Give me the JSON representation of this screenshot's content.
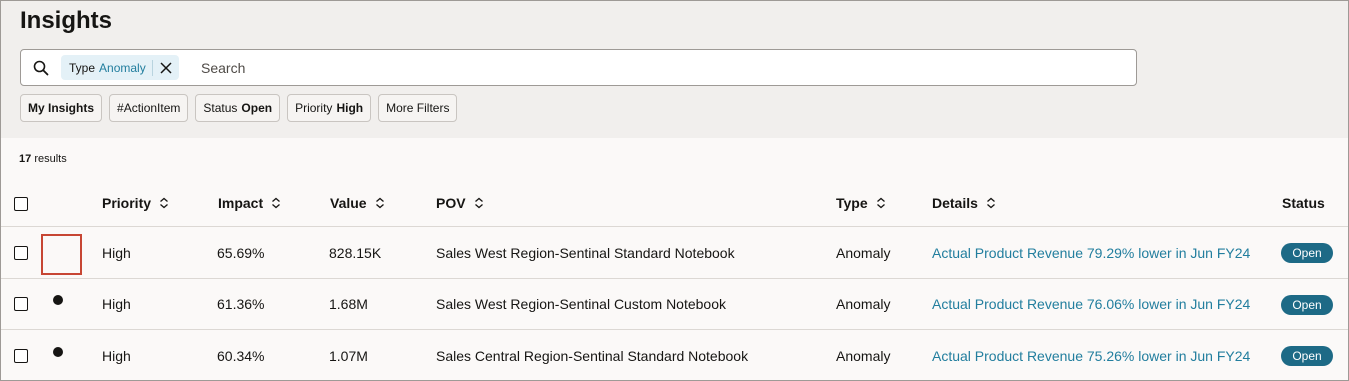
{
  "page": {
    "title": "Insights"
  },
  "search": {
    "placeholder": "Search",
    "chip": {
      "key": "Type",
      "value": "Anomaly"
    }
  },
  "filters": [
    {
      "label": "My Insights",
      "value": ""
    },
    {
      "label": "#ActionItem",
      "value": ""
    },
    {
      "label": "Status",
      "value": "Open"
    },
    {
      "label": "Priority",
      "value": "High"
    },
    {
      "label": "More Filters",
      "value": ""
    }
  ],
  "results": {
    "count": "17",
    "label": "results"
  },
  "table": {
    "columns": {
      "priority": "Priority",
      "impact": "Impact",
      "value": "Value",
      "pov": "POV",
      "type": "Type",
      "details": "Details",
      "status": "Status"
    },
    "rows": [
      {
        "priority": "High",
        "impact": "65.69%",
        "value": "828.15K",
        "pov": "Sales West Region-Sentinal Standard Notebook",
        "type": "Anomaly",
        "details": "Actual Product Revenue 79.29% lower in Jun FY24",
        "status": "Open",
        "unread": false
      },
      {
        "priority": "High",
        "impact": "61.36%",
        "value": "1.68M",
        "pov": "Sales West Region-Sentinal Custom Notebook",
        "type": "Anomaly",
        "details": "Actual Product Revenue 76.06% lower in Jun FY24",
        "status": "Open",
        "unread": true
      },
      {
        "priority": "High",
        "impact": "60.34%",
        "value": "1.07M",
        "pov": "Sales Central Region-Sentinal Standard Notebook",
        "type": "Anomaly",
        "details": "Actual Product Revenue 75.26% lower in Jun FY24",
        "status": "Open",
        "unread": true
      }
    ]
  },
  "colors": {
    "accent": "#227e9e",
    "badge": "#1d6a86",
    "focus": "#c74634"
  }
}
